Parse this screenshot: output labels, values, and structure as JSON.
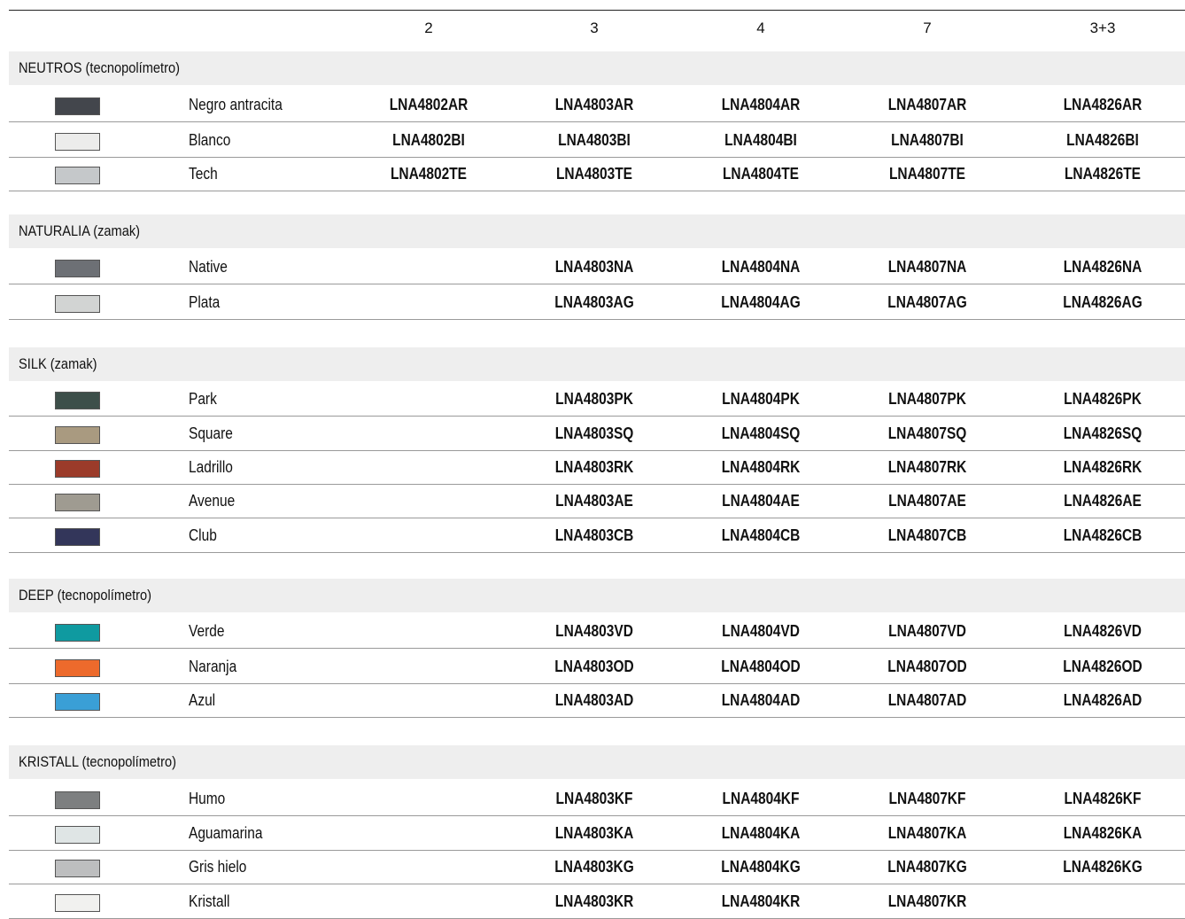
{
  "columns": [
    "2",
    "3",
    "4",
    "7",
    "3+3"
  ],
  "sections": [
    {
      "title": "NEUTROS (tecnopolímetro)",
      "rows": [
        {
          "name": "Negro antracita",
          "color": "#43464c",
          "codes": [
            "LNA4802AR",
            "LNA4803AR",
            "LNA4804AR",
            "LNA4807AR",
            "LNA4826AR"
          ]
        },
        {
          "name": "Blanco",
          "color": "#ececeb",
          "codes": [
            "LNA4802BI",
            "LNA4803BI",
            "LNA4804BI",
            "LNA4807BI",
            "LNA4826BI"
          ]
        },
        {
          "name": "Tech",
          "color": "#c5c8ca",
          "codes": [
            "LNA4802TE",
            "LNA4803TE",
            "LNA4804TE",
            "LNA4807TE",
            "LNA4826TE"
          ]
        }
      ]
    },
    {
      "title": "NATURALIA (zamak)",
      "rows": [
        {
          "name": "Native",
          "color": "#6d7075",
          "codes": [
            "",
            "LNA4803NA",
            "LNA4804NA",
            "LNA4807NA",
            "LNA4826NA"
          ]
        },
        {
          "name": "Plata",
          "color": "#d2d4d3",
          "codes": [
            "",
            "LNA4803AG",
            "LNA4804AG",
            "LNA4807AG",
            "LNA4826AG"
          ]
        }
      ]
    },
    {
      "title": "SILK (zamak)",
      "rows": [
        {
          "name": "Park",
          "color": "#3d4f4a",
          "codes": [
            "",
            "LNA4803PK",
            "LNA4804PK",
            "LNA4807PK",
            "LNA4826PK"
          ]
        },
        {
          "name": "Square",
          "color": "#a99a80",
          "codes": [
            "",
            "LNA4803SQ",
            "LNA4804SQ",
            "LNA4807SQ",
            "LNA4826SQ"
          ]
        },
        {
          "name": "Ladrillo",
          "color": "#9b3b2a",
          "codes": [
            "",
            "LNA4803RK",
            "LNA4804RK",
            "LNA4807RK",
            "LNA4826RK"
          ]
        },
        {
          "name": "Avenue",
          "color": "#9f9b91",
          "codes": [
            "",
            "LNA4803AE",
            "LNA4804AE",
            "LNA4807AE",
            "LNA4826AE"
          ]
        },
        {
          "name": "Club",
          "color": "#33365a",
          "codes": [
            "",
            "LNA4803CB",
            "LNA4804CB",
            "LNA4807CB",
            "LNA4826CB"
          ]
        }
      ]
    },
    {
      "title": "DEEP (tecnopolímetro)",
      "rows": [
        {
          "name": "Verde",
          "color": "#0f9aa0",
          "codes": [
            "",
            "LNA4803VD",
            "LNA4804VD",
            "LNA4807VD",
            "LNA4826VD"
          ]
        },
        {
          "name": "Naranja",
          "color": "#ed6a2c",
          "codes": [
            "",
            "LNA4803OD",
            "LNA4804OD",
            "LNA4807OD",
            "LNA4826OD"
          ]
        },
        {
          "name": "Azul",
          "color": "#3a9fd6",
          "codes": [
            "",
            "LNA4803AD",
            "LNA4804AD",
            "LNA4807AD",
            "LNA4826AD"
          ]
        }
      ]
    },
    {
      "title": "KRISTALL (tecnopolímetro)",
      "rows": [
        {
          "name": "Humo",
          "color": "#7d7f80",
          "codes": [
            "",
            "LNA4803KF",
            "LNA4804KF",
            "LNA4807KF",
            "LNA4826KF"
          ]
        },
        {
          "name": "Aguamarina",
          "color": "#dfe5e5",
          "codes": [
            "",
            "LNA4803KA",
            "LNA4804KA",
            "LNA4807KA",
            "LNA4826KA"
          ]
        },
        {
          "name": "Gris hielo",
          "color": "#bdbebf",
          "codes": [
            "",
            "LNA4803KG",
            "LNA4804KG",
            "LNA4807KG",
            "LNA4826KG"
          ]
        },
        {
          "name": "Kristall",
          "color": "#f1f1ef",
          "codes": [
            "",
            "LNA4803KR",
            "LNA4804KR",
            "LNA4807KR",
            ""
          ]
        }
      ]
    }
  ]
}
